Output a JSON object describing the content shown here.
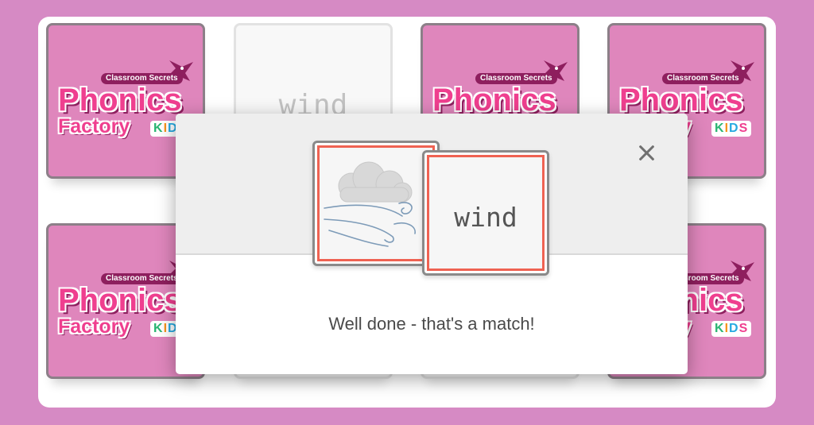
{
  "board": {
    "logo": {
      "tagline": "Classroom Secrets",
      "main": "Phonics",
      "sub": "Factory",
      "kids": [
        "K",
        "I",
        "D",
        "S"
      ]
    },
    "revealed_word": "wind",
    "cards": [
      {
        "state": "back"
      },
      {
        "state": "face",
        "word": "wind"
      },
      {
        "state": "back"
      },
      {
        "state": "back"
      },
      {
        "state": "back"
      },
      {
        "state": "face"
      },
      {
        "state": "face"
      },
      {
        "state": "back"
      }
    ]
  },
  "modal": {
    "picture_card": {
      "icon": "wind-cloud-icon"
    },
    "word_card": {
      "word": "wind"
    },
    "message": "Well done - that's a match!",
    "close_icon": "close-icon"
  },
  "colors": {
    "background": "#d68ac4",
    "card_back": "#df86bc",
    "card_border_match": "#ef6252",
    "logo_pink": "#ef3f8f"
  }
}
